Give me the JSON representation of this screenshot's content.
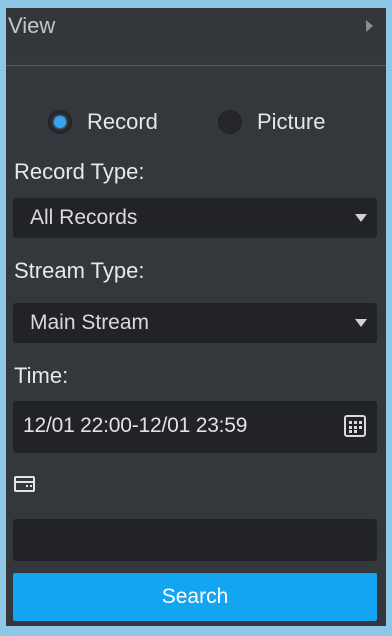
{
  "header": {
    "title": "View",
    "arrow_icon": "caret-right-icon"
  },
  "mode": {
    "options": [
      {
        "label": "Record",
        "checked": true
      },
      {
        "label": "Picture",
        "checked": false
      }
    ],
    "accent_color": "#3aa3ee"
  },
  "record_type": {
    "label": "Record Type:",
    "value": "All Records"
  },
  "stream_type": {
    "label": "Stream Type:",
    "value": "Main Stream"
  },
  "time": {
    "label": "Time:",
    "value": "12/01 22:00-12/01 23:59",
    "icon": "calendar-icon"
  },
  "card": {
    "icon": "card-icon",
    "value": ""
  },
  "search": {
    "label": "Search",
    "color": "#13a4f2"
  }
}
